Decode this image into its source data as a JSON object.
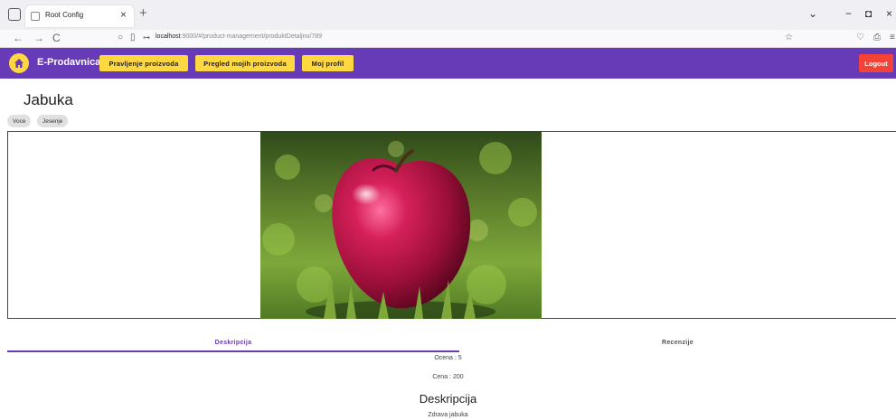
{
  "browser": {
    "tab_title": "Root Config",
    "tab_close": "×",
    "new_tab": "+",
    "url_host": "localhost",
    "url_rest": ":9000/#/product-management/produktDetaljno/789",
    "back": "←",
    "forward": "→",
    "reload": "C",
    "minimize": "−",
    "restore": "◘",
    "close": "×",
    "dropdown": "⌄"
  },
  "header": {
    "brand": "E-Prodavnica",
    "buttons": [
      "Pravljenje proizvoda",
      "Pregled mojih proizvoda",
      "Moj profil"
    ],
    "logout": "Logout",
    "accent": "#673ab7",
    "button_color": "#ffd740",
    "logout_color": "#f44336"
  },
  "product": {
    "title": "Jabuka",
    "tags": [
      "Voce",
      "Jesenje"
    ]
  },
  "tabs": {
    "items": [
      "Deskripcija",
      "Recenzije"
    ],
    "active": "Deskripcija"
  },
  "details": {
    "rating_label": "Ocena :",
    "rating_value": "5",
    "price_label": "Cena :",
    "price_value": "200",
    "description_heading": "Deskripcija",
    "description_text": "Zdrava jabuka"
  }
}
